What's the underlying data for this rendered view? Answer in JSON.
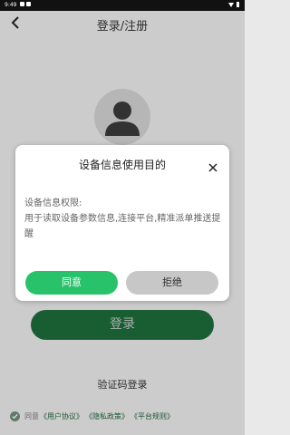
{
  "status_bar": {
    "time": "9:49"
  },
  "header": {
    "title": "登录/注册"
  },
  "login_button_label": "登录",
  "code_login_label": "验证码登录",
  "agreement": {
    "prefix": "同意",
    "links": [
      "《用户协议》",
      "《隐私政策》",
      "《平台规则》"
    ]
  },
  "dialog": {
    "title": "设备信息使用目的",
    "body_line1": "设备信息权限:",
    "body_line2": "用于读取设备参数信息,连接平台,精准派单推送提醒",
    "agree_label": "同意",
    "refuse_label": "拒绝"
  },
  "colors": {
    "primary_green": "#27c26a",
    "login_button_green": "#1d6b3b",
    "refuse_gray": "#c7c7c7"
  },
  "icons": [
    "back-arrow-icon",
    "avatar-icon",
    "close-icon",
    "check-icon"
  ]
}
